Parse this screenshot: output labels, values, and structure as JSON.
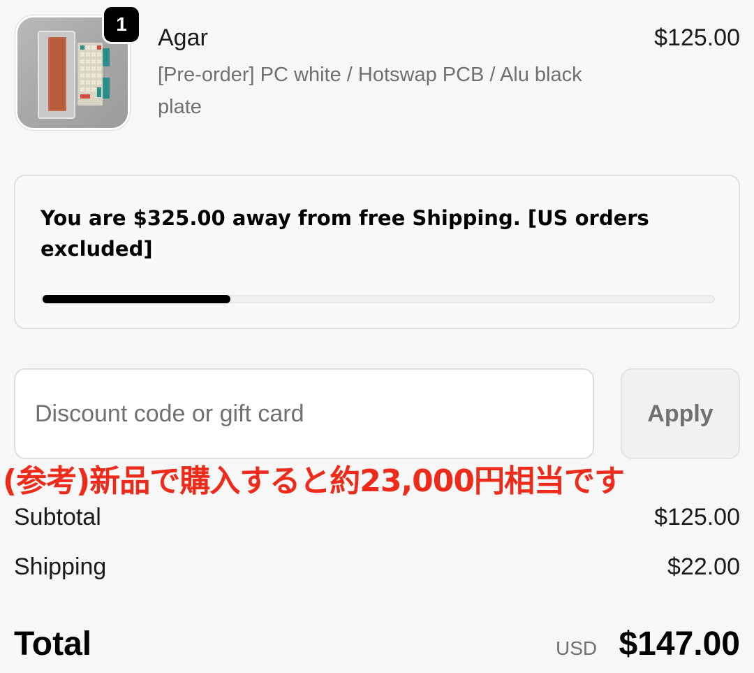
{
  "line_item": {
    "quantity": "1",
    "name": "Agar",
    "variant": "[Pre-order] PC white / Hotswap PCB / Alu black plate",
    "price": "$125.00",
    "thumbnail_icon": "keyboard-product-image"
  },
  "free_shipping": {
    "message": "You are $325.00 away from free Shipping. [US orders excluded]",
    "progress_fraction": 0.28
  },
  "discount": {
    "placeholder": "Discount code or gift card",
    "value": "",
    "apply_label": "Apply"
  },
  "overlay_note": "(参考)新品で購入すると約23,000円相当です",
  "summary": {
    "subtotal_label": "Subtotal",
    "subtotal_value": "$125.00",
    "shipping_label": "Shipping",
    "shipping_value": "$22.00",
    "total_label": "Total",
    "currency": "USD",
    "total_value": "$147.00"
  },
  "colors": {
    "background": "#f7f7f7",
    "overlay_red": "#ee2b1a",
    "progress": "#000000",
    "muted_text": "#707070"
  }
}
